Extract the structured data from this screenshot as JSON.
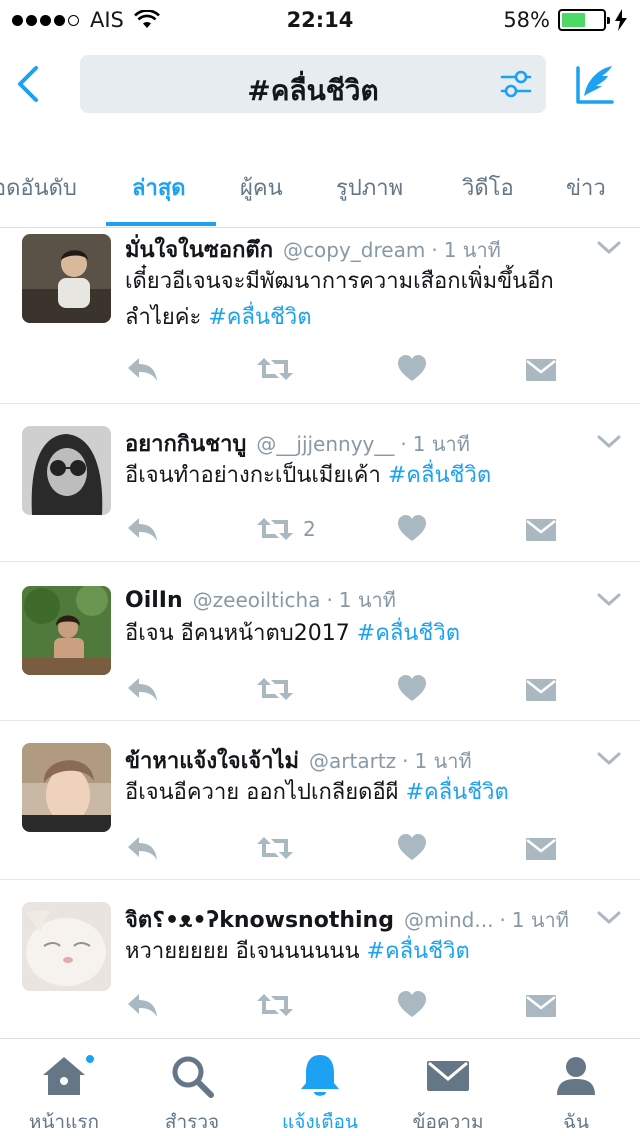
{
  "status_bar": {
    "carrier": "AIS",
    "time": "22:14",
    "battery": "58%",
    "battery_level": 0.58
  },
  "search": {
    "query": "#คลื่นชีวิต"
  },
  "tabs": [
    {
      "label": "ยอดอันดับ",
      "active": false
    },
    {
      "label": "ล่าสุด",
      "active": true
    },
    {
      "label": "ผู้คน",
      "active": false
    },
    {
      "label": "รูปภาพ",
      "active": false
    },
    {
      "label": "วิดีโอ",
      "active": false
    },
    {
      "label": "ข่าว",
      "active": false
    }
  ],
  "tweets": [
    {
      "name": "มั่นใจในซอกตึก",
      "handle": "@copy_dream",
      "dot": "·",
      "time": "1 นาที",
      "text_line1": "เดี๋ยวอีเจนจะมีพัฒนาการความเสือกเพิ่มขึ้นอีก",
      "text_line2": "ลำไยค่ะ ",
      "hashtag": "#คลื่นชีวิต",
      "retweet_count": ""
    },
    {
      "name": "อยากกินชาบู",
      "handle": "@__jjjennyy__",
      "dot": "·",
      "time": "1 นาที",
      "text_line1": "อีเจนทำอย่างกะเป็นเมียเค้า ",
      "hashtag": "#คลื่นชีวิต",
      "retweet_count": "2"
    },
    {
      "name": "OilIn",
      "handle": "@zeeoilticha",
      "dot": "·",
      "time": "1 นาที",
      "text_line1": "อีเจน อีคนหน้าตบ2017 ",
      "hashtag": "#คลื่นชีวิต",
      "retweet_count": ""
    },
    {
      "name": "ข้าหาแจ้งใจเจ้าไม่",
      "handle": "@artartz",
      "dot": "·",
      "time": "1 นาที",
      "text_line1": "อีเจนอีควาย ออกไปเกลียดอีผี ",
      "hashtag": "#คลื่นชีวิต",
      "retweet_count": ""
    },
    {
      "name": "จิต؟•ᴥ•ʔknowsnothing",
      "handle": "@mind...",
      "dot": "·",
      "time": "1 นาที",
      "text_line1": "หวายยยยย อีเจนนนนนน ",
      "hashtag": "#คลื่นชีวิต",
      "retweet_count": ""
    }
  ],
  "tabbar": [
    {
      "label": "หน้าแรก",
      "icon": "home-icon",
      "active": false
    },
    {
      "label": "สำรวจ",
      "icon": "search-icon",
      "active": false
    },
    {
      "label": "แจ้งเตือน",
      "icon": "bell-icon",
      "active": true
    },
    {
      "label": "ข้อความ",
      "icon": "envelope-icon",
      "active": false
    },
    {
      "label": "ฉัน",
      "icon": "person-icon",
      "active": false
    }
  ],
  "colors": {
    "accent": "#1da1f2",
    "icon_gray": "#aab8c2",
    "text_secondary": "#657786"
  }
}
